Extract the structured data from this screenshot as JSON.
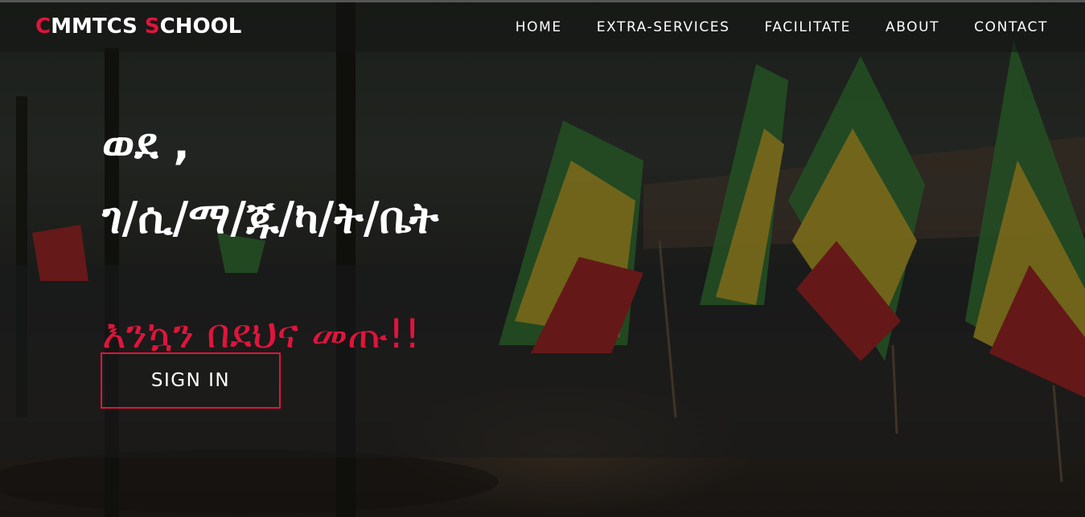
{
  "brand": {
    "first_initial": "C",
    "first_rest": "MMTCS ",
    "second_initial": "S",
    "second_rest": "CHOOL",
    "accent_color": "#e0143c"
  },
  "nav": {
    "items": [
      {
        "label": "HOME"
      },
      {
        "label": "EXTRA-SERVICES"
      },
      {
        "label": "FACILITATE"
      },
      {
        "label": "ABOUT"
      },
      {
        "label": "CONTACT"
      }
    ]
  },
  "hero": {
    "line1": "ወደ ,",
    "line2": "ገ/ሲ/ማ/ጁ/ካ/ት/ቤት",
    "line3": "እንኳን በደህና መጡ!!",
    "button_label": "SIGN IN",
    "background_image": "crowd-of-students-with-flags-photo"
  },
  "colors": {
    "accent": "#e0143c",
    "text": "#ffffff",
    "header_bg": "rgba(20,22,20,0.55)"
  }
}
